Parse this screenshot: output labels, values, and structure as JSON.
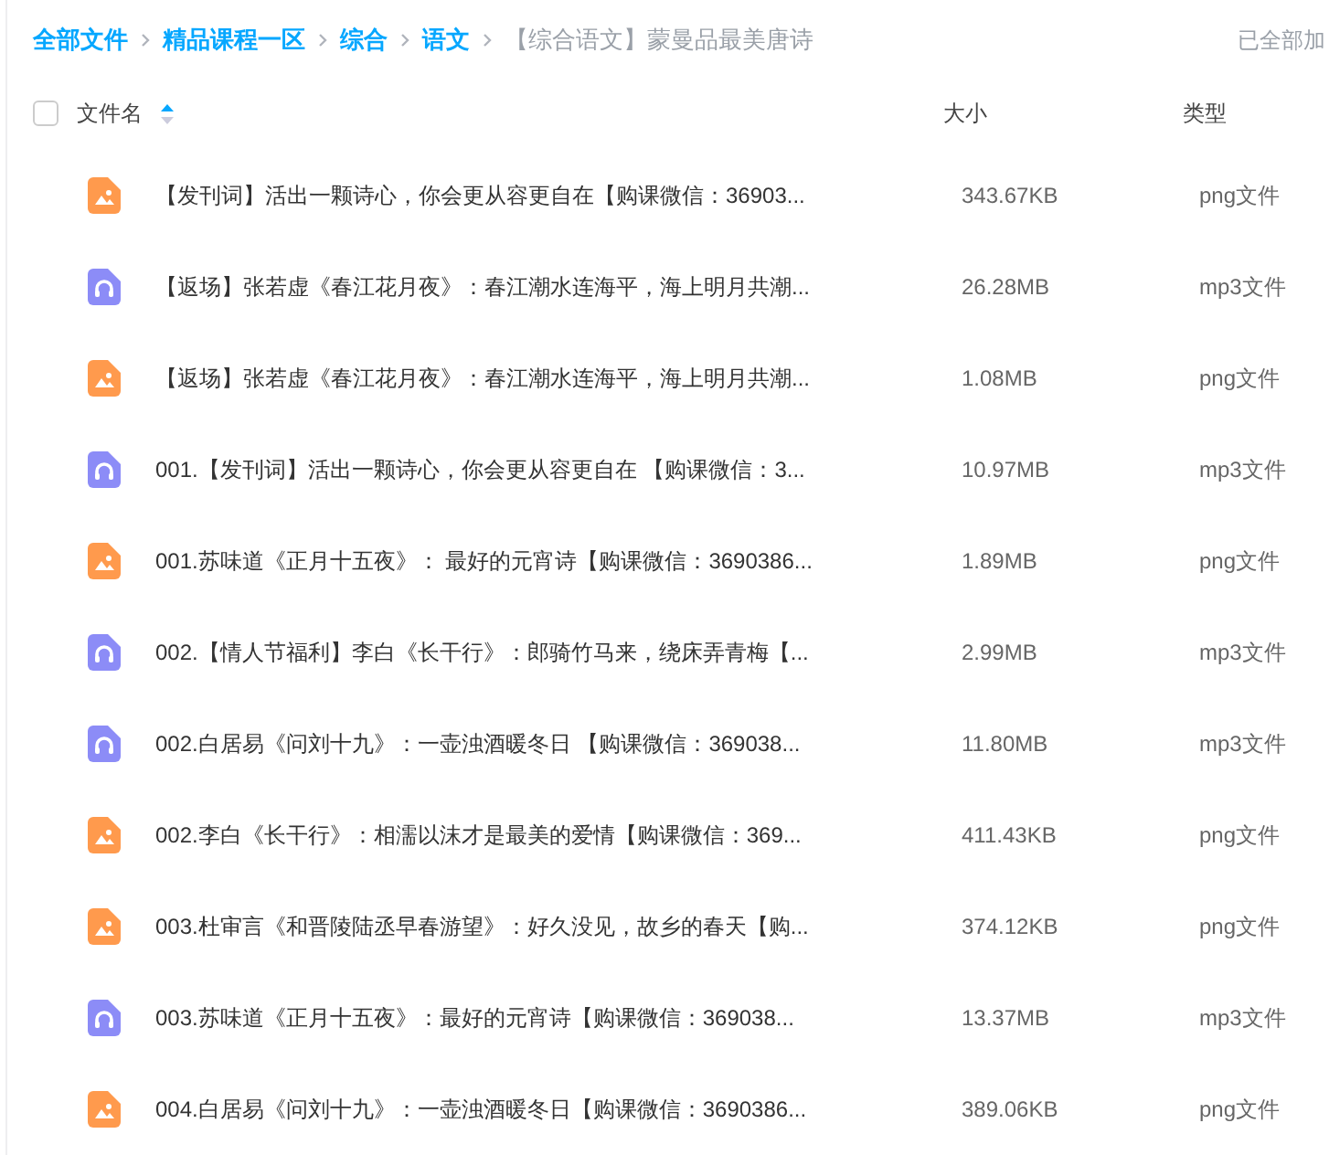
{
  "breadcrumb": [
    {
      "label": "全部文件",
      "current": false
    },
    {
      "label": "精品课程一区",
      "current": false
    },
    {
      "label": "综合",
      "current": false
    },
    {
      "label": "语文",
      "current": false
    },
    {
      "label": "【综合语文】蒙曼品最美唐诗",
      "current": true
    }
  ],
  "status": "已全部加",
  "columns": {
    "name": "文件名",
    "size": "大小",
    "type": "类型"
  },
  "select_all": {
    "checked": false
  },
  "files": [
    {
      "kind": "image",
      "name": "【发刊词】活出一颗诗心，你会更从容更自在【购课微信：36903...",
      "size": "343.67KB",
      "type": "png文件"
    },
    {
      "kind": "audio",
      "name": "【返场】张若虚《春江花月夜》：春江潮水连海平，海上明月共潮...",
      "size": "26.28MB",
      "type": "mp3文件"
    },
    {
      "kind": "image",
      "name": "【返场】张若虚《春江花月夜》：春江潮水连海平，海上明月共潮...",
      "size": "1.08MB",
      "type": "png文件"
    },
    {
      "kind": "audio",
      "name": "001.【发刊词】活出一颗诗心，你会更从容更自在 【购课微信：3...",
      "size": "10.97MB",
      "type": "mp3文件"
    },
    {
      "kind": "image",
      "name": "001.苏味道《正月十五夜》： 最好的元宵诗【购课微信：3690386...",
      "size": "1.89MB",
      "type": "png文件"
    },
    {
      "kind": "audio",
      "name": "002.【情人节福利】李白《长干行》：郎骑竹马来，绕床弄青梅【...",
      "size": "2.99MB",
      "type": "mp3文件"
    },
    {
      "kind": "audio",
      "name": "002.白居易《问刘十九》：一壶浊酒暖冬日 【购课微信：369038...",
      "size": "11.80MB",
      "type": "mp3文件"
    },
    {
      "kind": "image",
      "name": "002.李白《长干行》：相濡以沫才是最美的爱情【购课微信：369...",
      "size": "411.43KB",
      "type": "png文件"
    },
    {
      "kind": "image",
      "name": "003.杜审言《和晋陵陆丞早春游望》：好久没见，故乡的春天【购...",
      "size": "374.12KB",
      "type": "png文件"
    },
    {
      "kind": "audio",
      "name": "003.苏味道《正月十五夜》：最好的元宵诗【购课微信：369038...",
      "size": "13.37MB",
      "type": "mp3文件"
    },
    {
      "kind": "image",
      "name": "004.白居易《问刘十九》：一壶浊酒暖冬日【购课微信：3690386...",
      "size": "389.06KB",
      "type": "png文件"
    }
  ]
}
